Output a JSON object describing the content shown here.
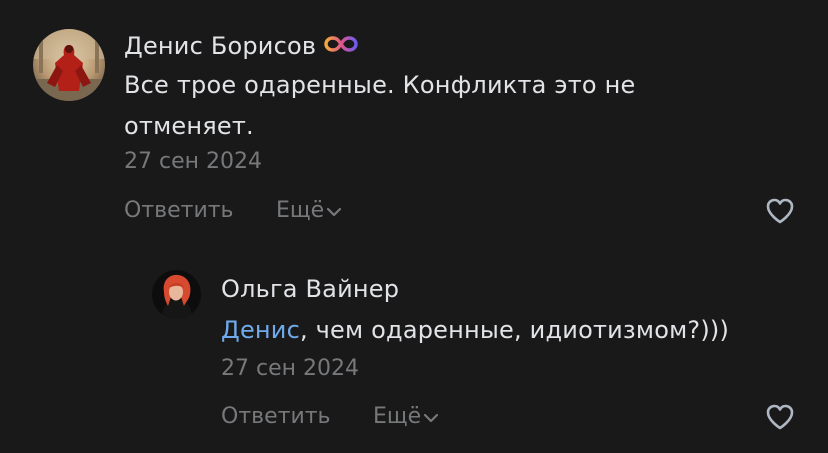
{
  "comments": [
    {
      "author": "Денис Борисов",
      "badge_icon": "infinity-badge-icon",
      "text": "Все трое одаренные. Конфликта это не отменяет.",
      "date": "27 сен 2024",
      "reply_label": "Ответить",
      "more_label": "Ещё",
      "like_icon": "heart-outline-icon"
    },
    {
      "author": "Ольга Вайнер",
      "mention": "Денис",
      "text": ", чем одаренные, идиотизмом?)))",
      "date": "27 сен 2024",
      "reply_label": "Ответить",
      "more_label": "Ещё",
      "like_icon": "heart-outline-icon"
    }
  ],
  "colors": {
    "background": "#19191a",
    "text_primary": "#e1e3e6",
    "text_secondary": "#76787a",
    "mention": "#71aaeb"
  }
}
